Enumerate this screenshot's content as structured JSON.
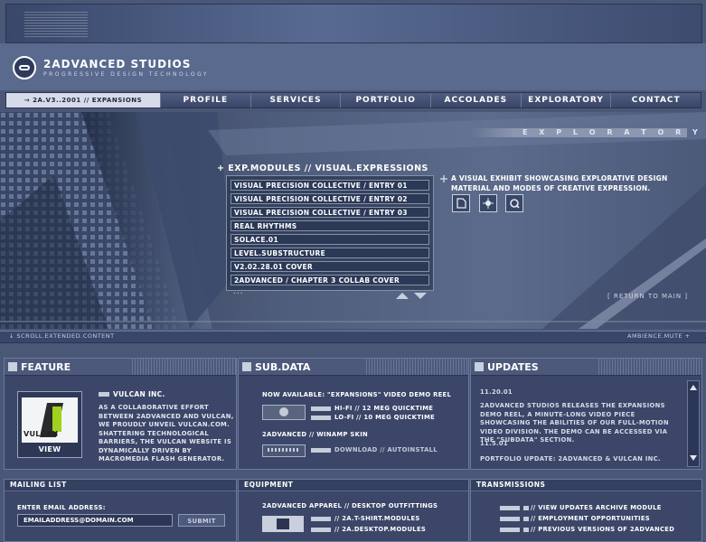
{
  "header": {
    "brand": "2ADVANCED STUDIOS",
    "tagline": "PROGRESSIVE DESIGN TECHNOLOGY"
  },
  "nav": {
    "current": "→ 2A.V3..2001 // EXPANSIONS",
    "items": [
      "PROFILE",
      "SERVICES",
      "PORTFOLIO",
      "ACCOLADES",
      "EXPLORATORY",
      "CONTACT"
    ]
  },
  "hero": {
    "section_title": "E X P L O R A T O R Y",
    "modules_title": "+ EXP.MODULES // VISUAL.EXPRESSIONS",
    "modules": [
      "VISUAL PRECISION COLLECTIVE / ENTRY 01",
      "VISUAL PRECISION COLLECTIVE / ENTRY 02",
      "VISUAL PRECISION COLLECTIVE / ENTRY 03",
      "REAL RHYTHMS",
      "SOLACE.01",
      "LEVEL.SUBSTRUCTURE",
      "V2.02.28.01 COVER",
      "2ADVANCED / CHAPTER 3 COLLAB COVER"
    ],
    "more": "...",
    "description": "A VISUAL EXHIBIT SHOWCASING EXPLORATIVE DESIGN MATERIAL AND MODES OF CREATIVE EXPRESSION.",
    "return": "[ RETURN TO MAIN ]",
    "icons": [
      "document-icon",
      "splat-icon",
      "magnifier-icon"
    ]
  },
  "scrollbar": {
    "left": "SCROLL.EXTENDED.CONTENT",
    "right": "AMBIENCE.MUTE"
  },
  "feature": {
    "title": "FEATURE",
    "thumb_label": "VULCAN",
    "view": "VIEW",
    "heading": "VULCAN INC.",
    "body": "AS A COLLABORATIVE EFFORT BETWEEN 2ADVANCED AND VULCAN, WE PROUDLY UNVEIL VULCAN.COM. SHATTERING TECHNOLOGICAL BARRIERS, THE VULCAN WEBSITE IS DYNAMICALLY DRIVEN BY MACROMEDIA FLASH GENERATOR."
  },
  "subdata": {
    "title": "SUB.DATA",
    "reel": "NOW AVAILABLE: \"EXPANSIONS\" VIDEO DEMO REEL",
    "hifi": "HI-FI // 12 MEG QUICKTIME",
    "lofi": "LO-FI // 10 MEG QUICKTIME",
    "skin": "2ADVANCED // WINAMP SKIN",
    "download": "DOWNLOAD // AUTOINSTALL"
  },
  "updates": {
    "title": "UPDATES",
    "date1": "11.20.01",
    "text1": "2ADVANCED STUDIOS RELEASES THE EXPANSIONS DEMO REEL, A MINUTE-LONG VIDEO PIECE SHOWCASING THE ABILITIES OF OUR FULL-MOTION VIDEO DIVISION. THE DEMO CAN BE ACCESSED VIA THE \"SUBDATA\" SECTION.",
    "date2": "11.5.01",
    "text2": "PORTFOLIO UPDATE: 2ADVANCED & VULCAN INC."
  },
  "mailing": {
    "title": "MAILING LIST",
    "label": "ENTER EMAIL ADDRESS:",
    "placeholder": "EMAILADDRESS@DOMAIN.COM",
    "submit": "SUBMIT"
  },
  "equipment": {
    "title": "EQUIPMENT",
    "heading": "2ADVANCED APPAREL // DESKTOP OUTFITTINGS",
    "link1": "// 2A.T-SHIRT.MODULES",
    "link2": "// 2A.DESKTOP.MODULES"
  },
  "transmissions": {
    "title": "TRANSMISSIONS",
    "links": [
      "// VIEW UPDATES ARCHIVE MODULE",
      "// EMPLOYMENT OPPORTUNITIES",
      "// PREVIOUS VERSIONS OF 2ADVANCED"
    ]
  }
}
